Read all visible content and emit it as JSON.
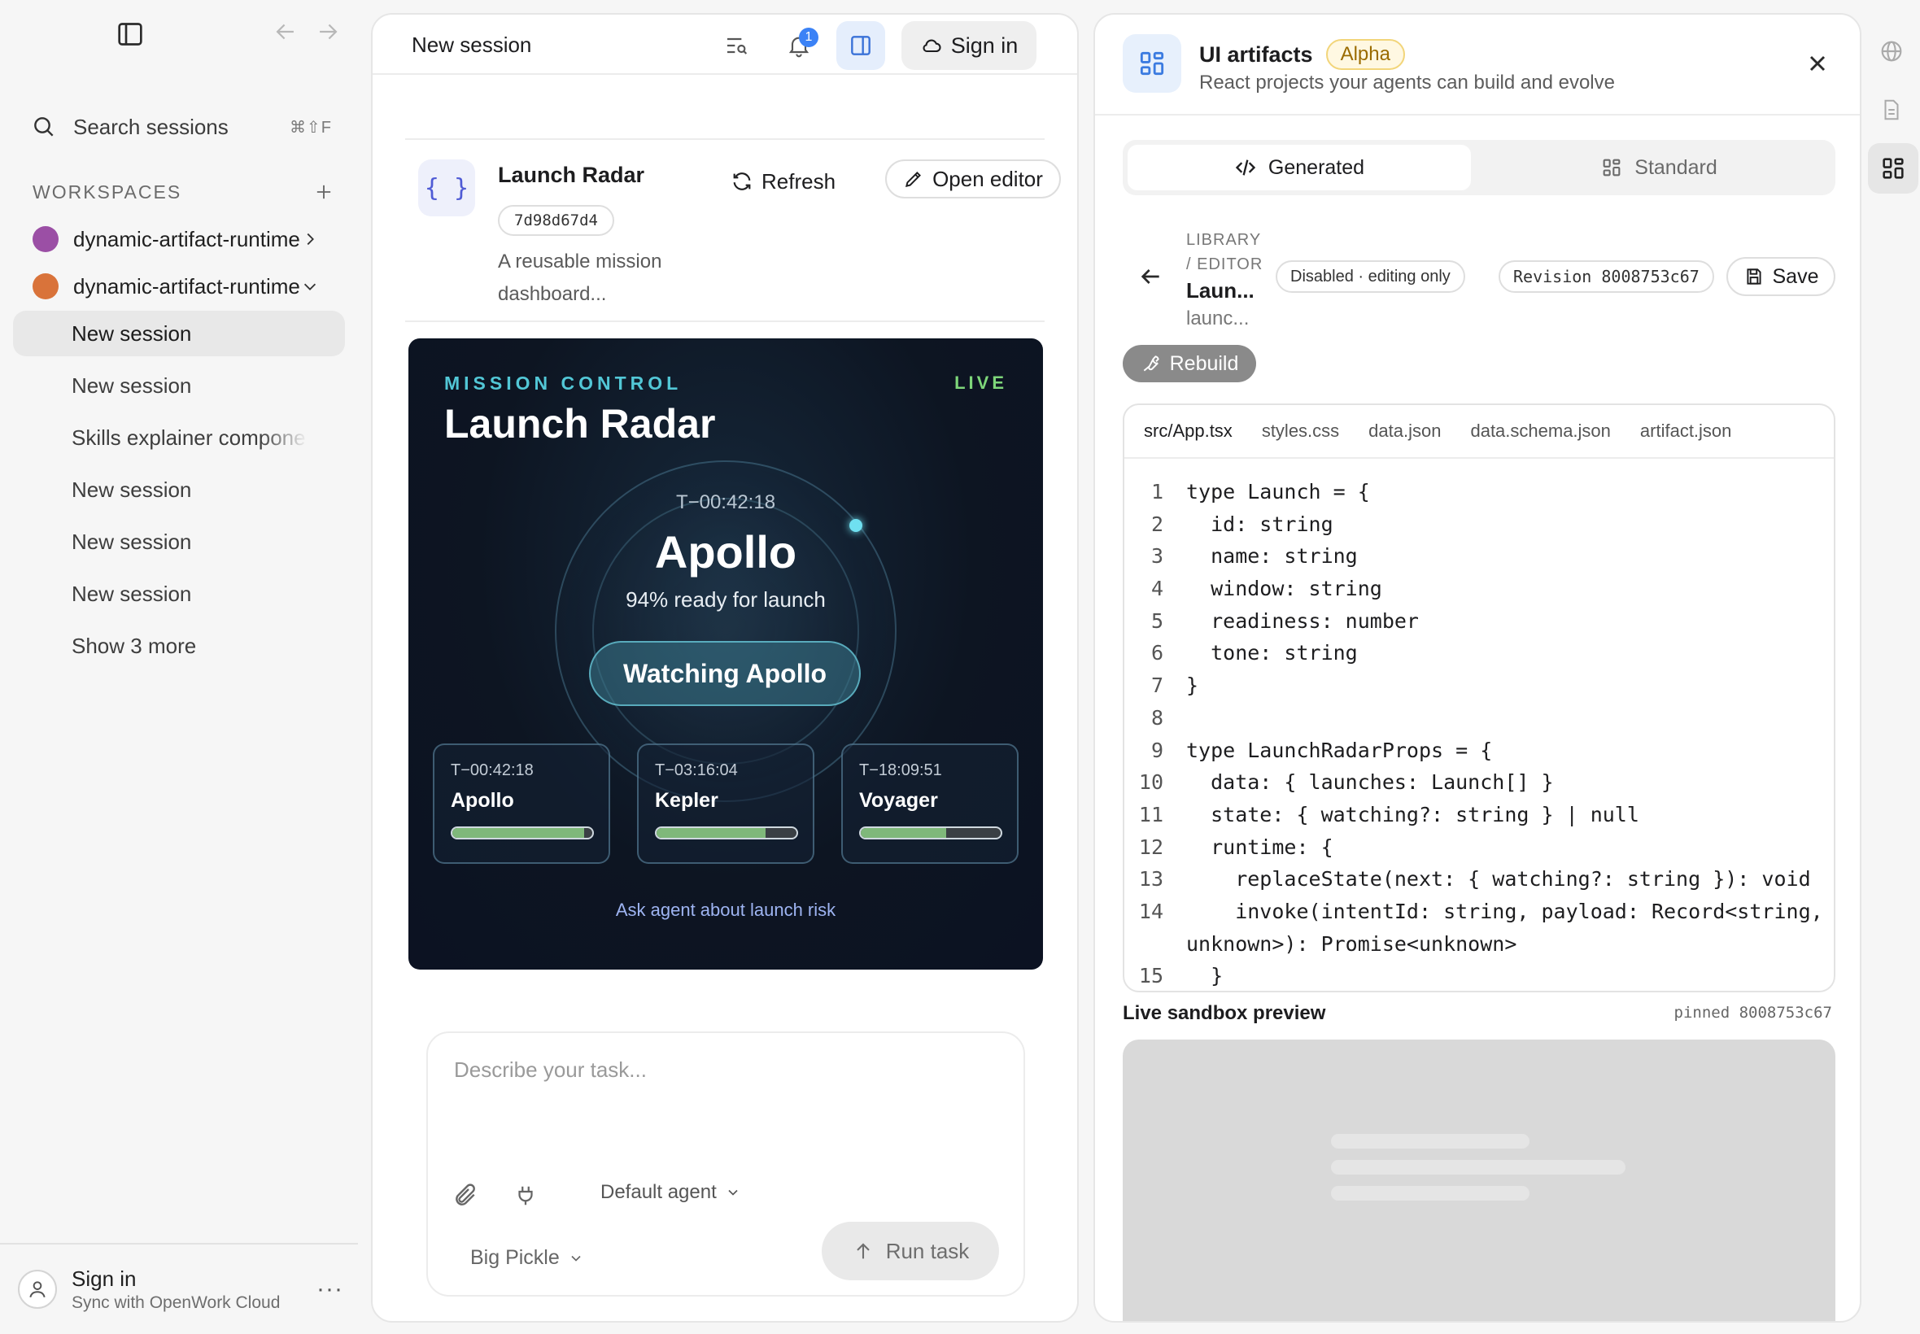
{
  "sidebar": {
    "search_label": "Search sessions",
    "search_shortcut": "⌘⇧F",
    "workspaces_heading": "WORKSPACES",
    "workspaces": [
      {
        "name": "dynamic-artifact-runtime",
        "color": "#9b4fa5"
      },
      {
        "name": "dynamic-artifact-runtime",
        "color": "#d9733a"
      }
    ],
    "sessions": [
      "New session",
      "New session",
      "Skills explainer component",
      "New session",
      "New session",
      "New session"
    ],
    "show_more": "Show 3 more",
    "footer": {
      "title": "Sign in",
      "subtitle": "Sync with OpenWork Cloud",
      "more": "···"
    }
  },
  "center": {
    "title": "New session",
    "notification_count": "1",
    "sign_in": "Sign in",
    "artifact": {
      "icon_glyph": "{ }",
      "name": "Launch Radar",
      "hash": "7d98d67d4",
      "description": "A reusable mission dashboard...",
      "refresh": "Refresh",
      "open_editor": "Open editor"
    },
    "dashboard": {
      "kicker": "MISSION CONTROL",
      "live": "LIVE",
      "title": "Launch Radar",
      "focus": {
        "tminus": "T−00:42:18",
        "name": "Apollo",
        "readiness": "94% ready for launch"
      },
      "watch_button": "Watching Apollo",
      "launches": [
        {
          "tminus": "T−00:42:18",
          "name": "Apollo",
          "readiness": 0.94
        },
        {
          "tminus": "T−03:16:04",
          "name": "Kepler",
          "readiness": 0.78
        },
        {
          "tminus": "T−18:09:51",
          "name": "Voyager",
          "readiness": 0.61
        }
      ],
      "ask_link": "Ask agent about launch risk"
    },
    "composer": {
      "placeholder": "Describe your task...",
      "agent": "Default agent",
      "model": "Big Pickle",
      "run": "Run task"
    }
  },
  "right": {
    "title": "UI artifacts",
    "badge": "Alpha",
    "subtitle": "React projects your agents can build and evolve",
    "tabs": [
      "Generated",
      "Standard"
    ],
    "crumb_1": "LIBRARY",
    "crumb_2": "/ EDITOR",
    "artifact_short": "Laun...",
    "artifact_sub": "launc...",
    "status_pill": "Disabled · editing only",
    "revision_pill": "Revision 8008753c67",
    "save": "Save",
    "rebuild": "Rebuild",
    "file_tabs": [
      "src/App.tsx",
      "styles.css",
      "data.json",
      "data.schema.json",
      "artifact.json"
    ],
    "code_lines": [
      {
        "n": "1",
        "t": "type Launch = {"
      },
      {
        "n": "2",
        "t": "  id: string"
      },
      {
        "n": "3",
        "t": "  name: string"
      },
      {
        "n": "4",
        "t": "  window: string"
      },
      {
        "n": "5",
        "t": "  readiness: number"
      },
      {
        "n": "6",
        "t": "  tone: string"
      },
      {
        "n": "7",
        "t": "}"
      },
      {
        "n": "8",
        "t": ""
      },
      {
        "n": "9",
        "t": "type LaunchRadarProps = {"
      },
      {
        "n": "10",
        "t": "  data: { launches: Launch[] }"
      },
      {
        "n": "11",
        "t": "  state: { watching?: string } | null"
      },
      {
        "n": "12",
        "t": "  runtime: {"
      },
      {
        "n": "13",
        "t": "    replaceState(next: { watching?: string }): void"
      },
      {
        "n": "14",
        "t": "    invoke(intentId: string, payload: Record<string,"
      },
      {
        "n": "",
        "t": "unknown>): Promise<unknown>"
      },
      {
        "n": "15",
        "t": "  }"
      }
    ],
    "preview_title": "Live sandbox preview",
    "preview_pin": "pinned 8008753c67"
  }
}
